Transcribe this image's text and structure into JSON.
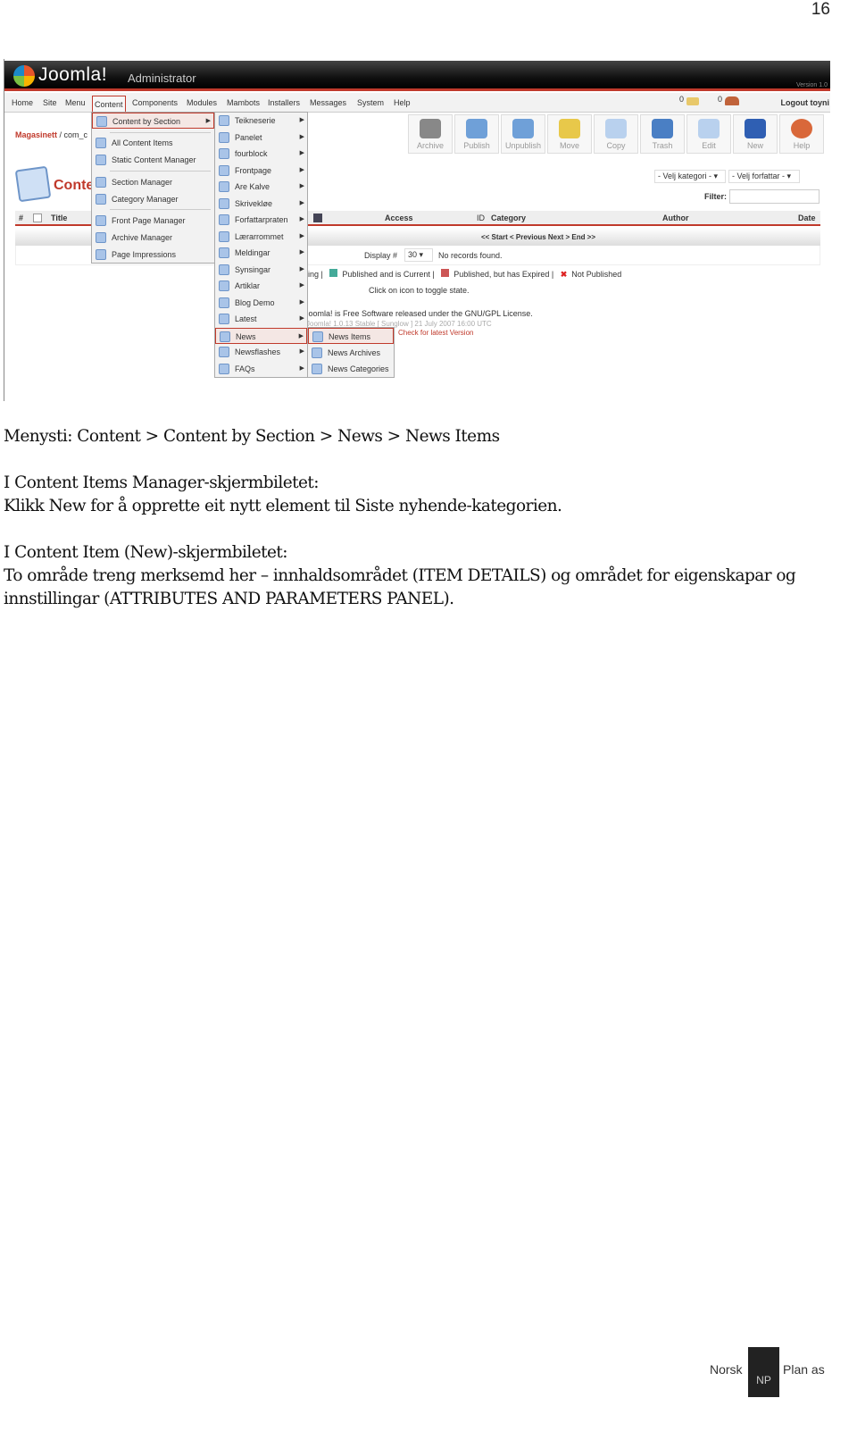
{
  "page_number": "16",
  "screenshot": {
    "logo": "Joomla!",
    "logo_sub": "Administrator",
    "version": "Version 1.0",
    "menu": [
      "Home",
      "Site",
      "Menu",
      "Content",
      "Components",
      "Modules",
      "Mambots",
      "Installers",
      "Messages",
      "System",
      "Help"
    ],
    "messages_count": "0",
    "users_count": "0",
    "logout": "Logout toyni",
    "breadcrumb_site": "Magasinett",
    "breadcrumb_rest": " / com_c",
    "toolbar": [
      "Archive",
      "Publish",
      "Unpublish",
      "Move",
      "Copy",
      "Trash",
      "Edit",
      "New",
      "Help"
    ],
    "page_title": "Conte",
    "category_select": "- Velj kategori -",
    "author_select": "- Velj forfattar -",
    "filter_label": "Filter:",
    "columns": {
      "num": "#",
      "title": "Title",
      "access": "Access",
      "id": "ID",
      "category": "Category",
      "author": "Author",
      "date": "Date"
    },
    "pagination": "<< Start < Previous Next > End >>",
    "display_label": "Display #",
    "display_value": "30",
    "no_records": "No records found.",
    "legend": {
      "partial": "ing |",
      "current": "Published and is Current |",
      "expired": "Published, but has Expired |",
      "not_published": "Not Published"
    },
    "toggle_hint": "Click on icon to toggle state.",
    "footer1": "Joomla! is Free Software released under the GNU/GPL License.",
    "footer2": "Joomla! 1.0.13 Stable [ Sunglow ] 21 July 2007 16:00 UTC",
    "footer3": "Check for latest Version",
    "content_menu": [
      "Content by Section",
      "All Content Items",
      "Static Content Manager",
      "Section Manager",
      "Category Manager",
      "Front Page Manager",
      "Archive Manager",
      "Page Impressions"
    ],
    "sections": [
      "Teikneserie",
      "Panelet",
      "fourblock",
      "Frontpage",
      "Are Kalve",
      "Skrivekløe",
      "Forfattarpraten",
      "Lærarrommet",
      "Meldingar",
      "Synsingar",
      "Artiklar",
      "Blog Demo",
      "Latest",
      "News",
      "Newsflashes",
      "FAQs"
    ],
    "news_menu": [
      "News Items",
      "News Archives",
      "News Categories"
    ]
  },
  "text": {
    "path": "Menysti: Content > Content by Section > News > News Items",
    "p2a": "I Content Items Manager-skjermbiletet:",
    "p2b": "Klikk New for å opprette eit nytt element til Siste nyhende-kategorien.",
    "p3a": "I Content Item (New)-skjermbiletet:",
    "p3b": "To område treng merksemd her – innhaldsområdet (ITEM DETAILS) og området for eigenskapar og innstillingar (ATTRIBUTES AND PARAMETERS PANEL)."
  },
  "footer": {
    "left": "Norsk",
    "right": "Plan as",
    "mark": "NP"
  }
}
